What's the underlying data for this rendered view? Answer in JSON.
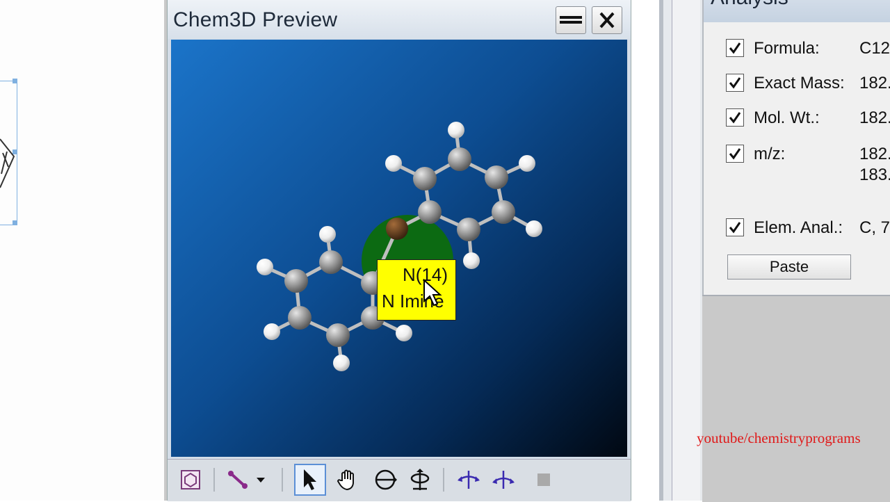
{
  "window": {
    "title": "Chem3D Preview",
    "buttons": [
      "menu",
      "close"
    ]
  },
  "tooltip": {
    "atom_label": "N(14)",
    "atom_type": "N Imine"
  },
  "toolbar": {
    "tools": [
      {
        "name": "chem3d-icon"
      },
      {
        "name": "bond-icon"
      },
      {
        "name": "select-arrow-icon",
        "active": true
      },
      {
        "name": "hand-icon"
      },
      {
        "name": "rotate-icon"
      },
      {
        "name": "move-icon"
      },
      {
        "name": "rotate-x-icon"
      },
      {
        "name": "rotate-y-icon"
      },
      {
        "name": "stop-icon"
      }
    ]
  },
  "analysis": {
    "title": "Analysis",
    "rows": [
      {
        "label": "Formula:",
        "value": "C12",
        "checked": true
      },
      {
        "label": "Exact Mass:",
        "value": "182.",
        "checked": true
      },
      {
        "label": "Mol. Wt.:",
        "value": "182.",
        "checked": true
      },
      {
        "label": "m/z:",
        "value": "182.",
        "value2": "183.",
        "checked": true
      },
      {
        "label": "Elem. Anal.:",
        "value": "C, 7",
        "checked": true
      }
    ],
    "paste_label": "Paste"
  },
  "watermark": "youtube/chemistryprograms",
  "colors": {
    "tooltip_bg": "#ffff00",
    "view_gradient_start": "#1b74c9",
    "view_gradient_end": "#010812",
    "watermark": "#e01919",
    "carbon": "#9a9a9a",
    "hydrogen": "#f4f4f4",
    "nitrogen_highlight": "#0c6a12"
  }
}
